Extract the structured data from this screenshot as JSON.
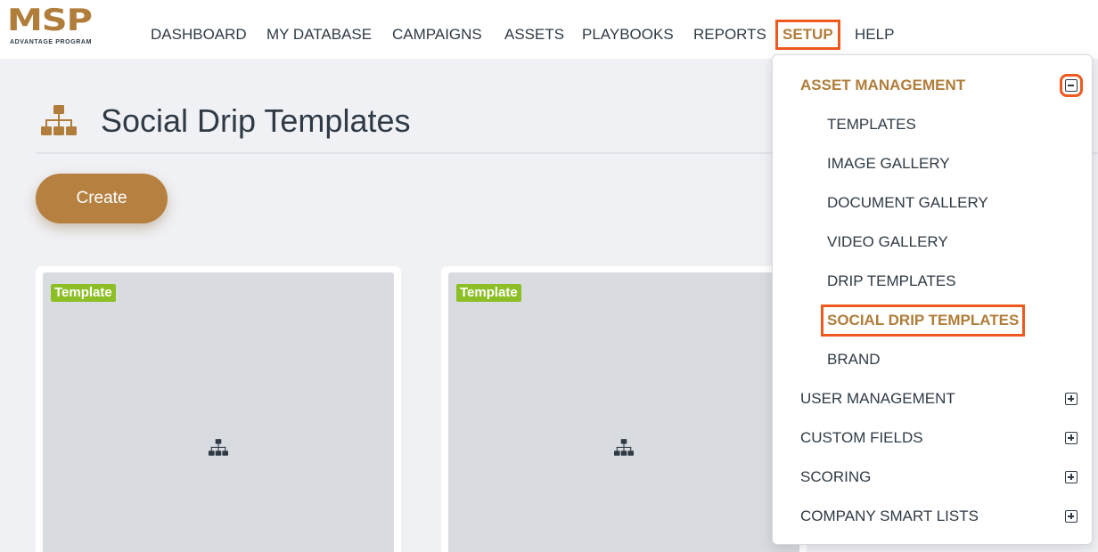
{
  "logo": {
    "text": "MSP",
    "subtitle": "ADVANTAGE PROGRAM"
  },
  "nav": {
    "items": [
      {
        "label": "DASHBOARD"
      },
      {
        "label": "MY DATABASE"
      },
      {
        "label": "CAMPAIGNS"
      },
      {
        "label": "ASSETS"
      },
      {
        "label": "PLAYBOOKS"
      },
      {
        "label": "REPORTS"
      },
      {
        "label": "SETUP",
        "active": true
      },
      {
        "label": "HELP"
      }
    ]
  },
  "page": {
    "title": "Social Drip Templates",
    "icon": "sitemap-icon",
    "create_label": "Create"
  },
  "cards": [
    {
      "badge": "Template",
      "icon": "sitemap-icon"
    },
    {
      "badge": "Template",
      "icon": "sitemap-icon"
    }
  ],
  "setup_menu": {
    "sections": [
      {
        "label": "ASSET MANAGEMENT",
        "expanded": true,
        "items": [
          {
            "label": "TEMPLATES"
          },
          {
            "label": "IMAGE GALLERY"
          },
          {
            "label": "DOCUMENT GALLERY"
          },
          {
            "label": "VIDEO GALLERY"
          },
          {
            "label": "DRIP TEMPLATES"
          },
          {
            "label": "SOCIAL DRIP TEMPLATES",
            "selected": true
          },
          {
            "label": "BRAND"
          }
        ]
      },
      {
        "label": "USER MANAGEMENT",
        "expanded": false
      },
      {
        "label": "CUSTOM FIELDS",
        "expanded": false
      },
      {
        "label": "SCORING",
        "expanded": false
      },
      {
        "label": "COMPANY SMART LISTS",
        "expanded": false
      }
    ]
  },
  "colors": {
    "brand": "#b07d3a",
    "highlight": "#ee5a1e",
    "badge": "#8cbf26",
    "text": "#2f3a45"
  }
}
